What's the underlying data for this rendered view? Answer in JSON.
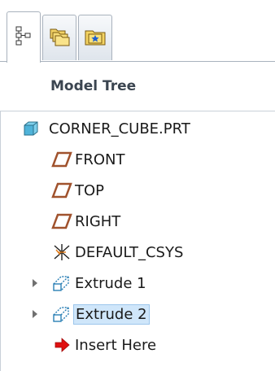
{
  "tabs": [
    {
      "icon": "tree-hierarchy-icon",
      "active": true
    },
    {
      "icon": "folders-icon",
      "active": false
    },
    {
      "icon": "favorites-star-icon",
      "active": false
    }
  ],
  "header": {
    "title": "Model Tree"
  },
  "tree": {
    "root": {
      "label": "CORNER_CUBE.PRT",
      "icon": "part-cube-icon"
    },
    "items": [
      {
        "label": "FRONT",
        "icon": "datum-plane-icon"
      },
      {
        "label": "TOP",
        "icon": "datum-plane-icon"
      },
      {
        "label": "RIGHT",
        "icon": "datum-plane-icon"
      },
      {
        "label": "DEFAULT_CSYS",
        "icon": "coordinate-system-icon"
      },
      {
        "label": "Extrude 1",
        "icon": "extrude-icon",
        "expandable": true
      },
      {
        "label": "Extrude 2",
        "icon": "extrude-icon",
        "expandable": true,
        "selected": true
      },
      {
        "label": "Insert Here",
        "icon": "insert-arrow-icon"
      }
    ]
  },
  "colors": {
    "datum_plane": "#a0522d",
    "selection": "#cfe6fa",
    "insert_arrow": "#e01010",
    "part_cube": "#4fb3d9"
  }
}
